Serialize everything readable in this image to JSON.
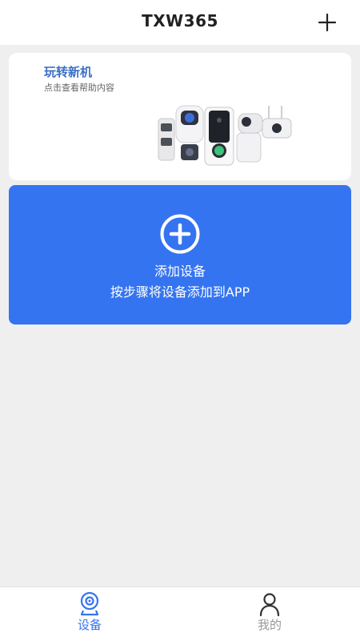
{
  "header": {
    "title": "TXW365",
    "add_icon": "plus-icon"
  },
  "help_card": {
    "title": "玩转新机",
    "subtitle": "点击查看帮助内容",
    "image": "camera-devices-illustration"
  },
  "add_device": {
    "icon": "plus-circle-icon",
    "title": "添加设备",
    "description": "按步骤将设备添加到APP"
  },
  "tabbar": {
    "tabs": [
      {
        "label": "设备",
        "icon": "camera-icon",
        "active": true
      },
      {
        "label": "我的",
        "icon": "person-icon",
        "active": false
      }
    ]
  },
  "colors": {
    "accent": "#3574f0",
    "background": "#efefef",
    "inactive_tab": "#999999",
    "help_title": "#3a6fc4"
  }
}
